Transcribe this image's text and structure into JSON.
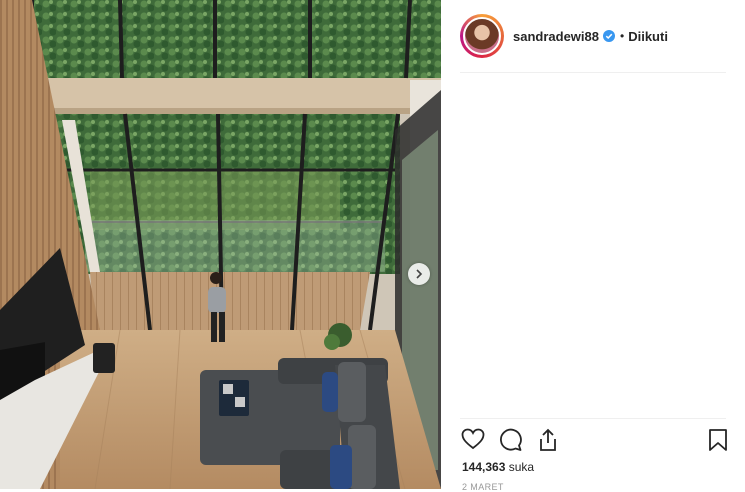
{
  "post": {
    "author": {
      "username": "sandradewi88",
      "verified": true,
      "separator": "•",
      "follow_status": "Diikuti"
    },
    "likes": {
      "count": "144,363",
      "unit": "suka"
    },
    "date": "2 MARET",
    "icons": {
      "like": "heart-icon",
      "comment": "comment-icon",
      "share": "share-icon",
      "save": "bookmark-icon",
      "next": "chevron-right-icon",
      "verified": "verified-badge-icon"
    },
    "colors": {
      "verified_blue": "#3897f0",
      "text": "#262626",
      "muted": "#999999"
    }
  }
}
